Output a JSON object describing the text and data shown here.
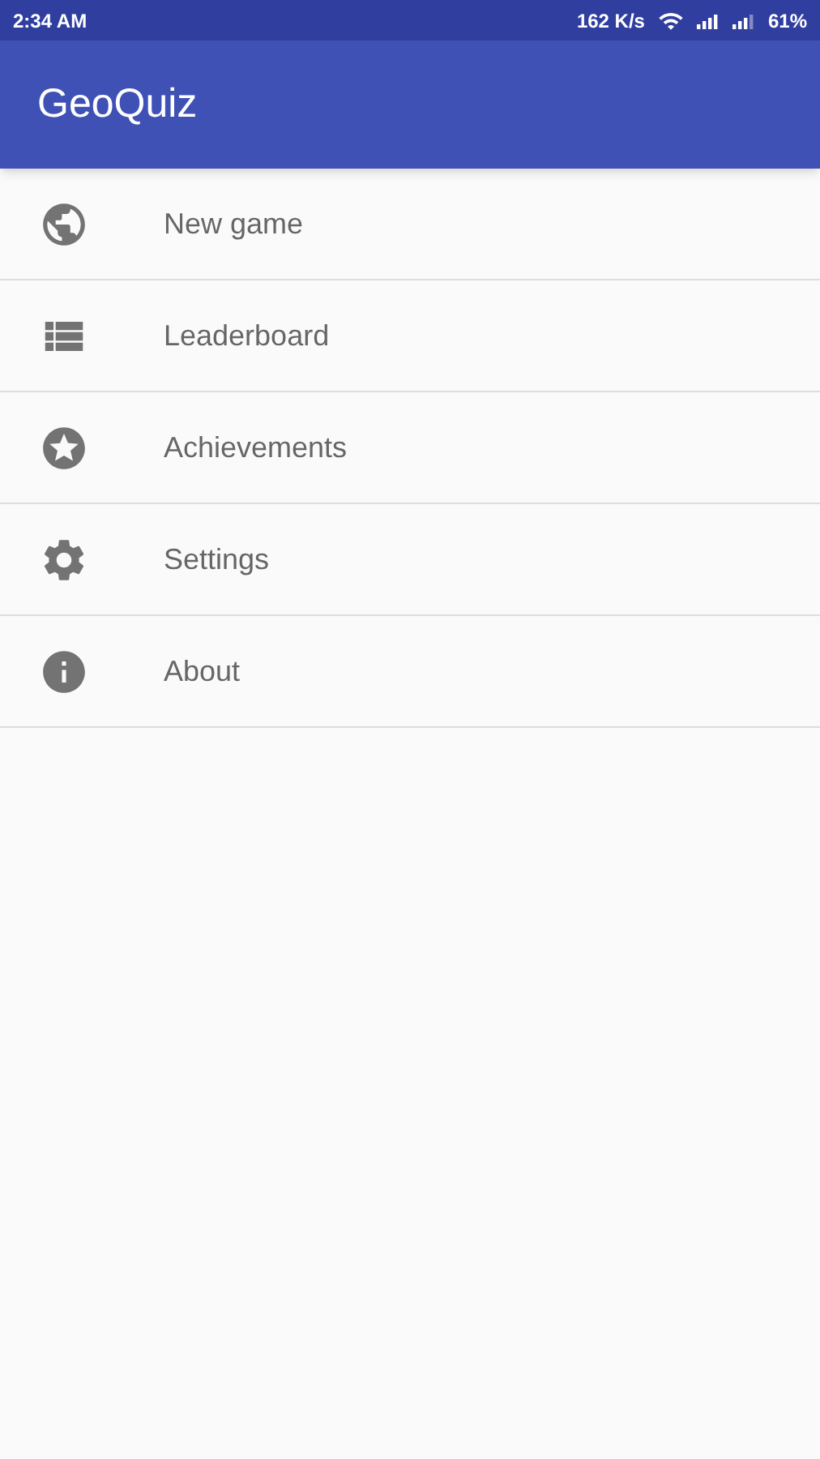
{
  "status_bar": {
    "time": "2:34 AM",
    "network_speed": "162 K/s",
    "battery": "61%"
  },
  "app_bar": {
    "title": "GeoQuiz"
  },
  "menu": {
    "items": [
      {
        "label": "New game"
      },
      {
        "label": "Leaderboard"
      },
      {
        "label": "Achievements"
      },
      {
        "label": "Settings"
      },
      {
        "label": "About"
      }
    ]
  }
}
